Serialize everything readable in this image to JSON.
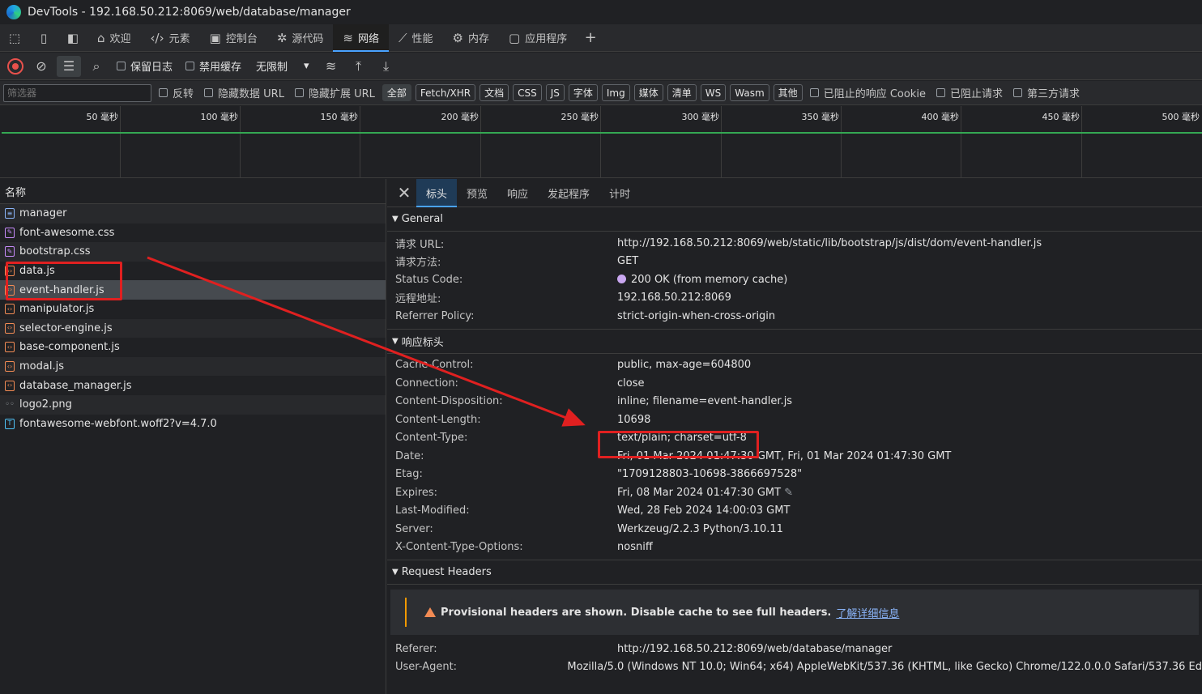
{
  "window": {
    "title": "DevTools - 192.168.50.212:8069/web/database/manager"
  },
  "tabs": [
    {
      "label": "欢迎",
      "icon": "home-icon"
    },
    {
      "label": "元素",
      "icon": "code-icon"
    },
    {
      "label": "控制台",
      "icon": "console-icon"
    },
    {
      "label": "源代码",
      "icon": "bug-icon"
    },
    {
      "label": "网络",
      "icon": "wifi-icon",
      "active": true
    },
    {
      "label": "性能",
      "icon": "performance-icon"
    },
    {
      "label": "内存",
      "icon": "memory-icon"
    },
    {
      "label": "应用程序",
      "icon": "app-icon"
    }
  ],
  "toolbar": {
    "preserve_log": "保留日志",
    "disable_cache": "禁用缓存",
    "throttle": "无限制"
  },
  "filter": {
    "placeholder": "筛选器",
    "invert": "反转",
    "hide_data_urls": "隐藏数据 URL",
    "hide_extension_urls": "隐藏扩展 URL",
    "types": [
      "全部",
      "Fetch/XHR",
      "文档",
      "CSS",
      "JS",
      "字体",
      "Img",
      "媒体",
      "清单",
      "WS",
      "Wasm",
      "其他"
    ],
    "blocked_cookies": "已阻止的响应 Cookie",
    "blocked_requests": "已阻止请求",
    "third_party": "第三方请求"
  },
  "timeline": {
    "ticks": [
      "50 毫秒",
      "100 毫秒",
      "150 毫秒",
      "200 毫秒",
      "250 毫秒",
      "300 毫秒",
      "350 毫秒",
      "400 毫秒",
      "450 毫秒",
      "500 毫秒"
    ]
  },
  "requests": {
    "header": "名称",
    "items": [
      {
        "name": "manager",
        "type": "doc"
      },
      {
        "name": "font-awesome.css",
        "type": "css"
      },
      {
        "name": "bootstrap.css",
        "type": "css"
      },
      {
        "name": "data.js",
        "type": "js"
      },
      {
        "name": "event-handler.js",
        "type": "js",
        "selected": true
      },
      {
        "name": "manipulator.js",
        "type": "js"
      },
      {
        "name": "selector-engine.js",
        "type": "js"
      },
      {
        "name": "base-component.js",
        "type": "js"
      },
      {
        "name": "modal.js",
        "type": "js"
      },
      {
        "name": "database_manager.js",
        "type": "js"
      },
      {
        "name": "logo2.png",
        "type": "img"
      },
      {
        "name": "fontawesome-webfont.woff2?v=4.7.0",
        "type": "font"
      }
    ]
  },
  "detail_tabs": [
    "标头",
    "预览",
    "响应",
    "发起程序",
    "计时"
  ],
  "general": {
    "title": "General",
    "rows": [
      {
        "k": "请求 URL:",
        "v": "http://192.168.50.212:8069/web/static/lib/bootstrap/js/dist/dom/event-handler.js"
      },
      {
        "k": "请求方法:",
        "v": "GET"
      },
      {
        "k": "Status Code:",
        "v": "200 OK (from memory cache)"
      },
      {
        "k": "远程地址:",
        "v": "192.168.50.212:8069"
      },
      {
        "k": "Referrer Policy:",
        "v": "strict-origin-when-cross-origin"
      }
    ]
  },
  "response_headers": {
    "title": "响应标头",
    "rows": [
      {
        "k": "Cache-Control:",
        "v": "public, max-age=604800"
      },
      {
        "k": "Connection:",
        "v": "close"
      },
      {
        "k": "Content-Disposition:",
        "v": "inline; filename=event-handler.js"
      },
      {
        "k": "Content-Length:",
        "v": "10698"
      },
      {
        "k": "Content-Type:",
        "v": "text/plain; charset=utf-8"
      },
      {
        "k": "Date:",
        "v": "Fri, 01 Mar 2024 01:47:30 GMT, Fri, 01 Mar 2024 01:47:30 GMT"
      },
      {
        "k": "Etag:",
        "v": "\"1709128803-10698-3866697528\""
      },
      {
        "k": "Expires:",
        "v": "Fri, 08 Mar 2024 01:47:30 GMT"
      },
      {
        "k": "Last-Modified:",
        "v": "Wed, 28 Feb 2024 14:00:03 GMT"
      },
      {
        "k": "Server:",
        "v": "Werkzeug/2.2.3 Python/3.10.11"
      },
      {
        "k": "X-Content-Type-Options:",
        "v": "nosniff"
      }
    ]
  },
  "request_headers": {
    "title": "Request Headers",
    "warning": "Provisional headers are shown. Disable cache to see full headers.",
    "learn_more": "了解详细信息",
    "rows": [
      {
        "k": "Referer:",
        "v": "http://192.168.50.212:8069/web/database/manager"
      },
      {
        "k": "User-Agent:",
        "v": "Mozilla/5.0 (Windows NT 10.0; Win64; x64) AppleWebKit/537.36 (KHTML, like Gecko) Chrome/122.0.0.0 Safari/537.36 Ed"
      }
    ]
  },
  "colors": {
    "accent": "#4aa3ff",
    "annotation": "#e02020",
    "record": "#e8514c"
  }
}
